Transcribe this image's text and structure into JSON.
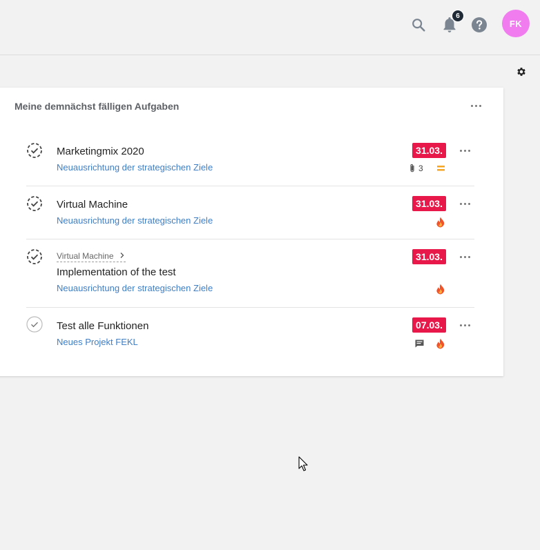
{
  "header": {
    "notification_count": "6",
    "avatar_initials": "FK",
    "avatar_color": "#f07cf0"
  },
  "widget": {
    "title": "Meine demnächst fälligen Aufgaben",
    "tasks": [
      {
        "title": "Marketingmix 2020",
        "project": "Neuausrichtung der strategischen Ziele",
        "due": "31.03.",
        "status_icon": "dashed-check-circle-icon",
        "attachments": "3",
        "priority_icon": "equals-priority-icon"
      },
      {
        "title": "Virtual Machine",
        "project": "Neuausrichtung der strategischen Ziele",
        "due": "31.03.",
        "status_icon": "dashed-check-circle-icon",
        "priority_icon": "fire-icon"
      },
      {
        "parent": "Virtual Machine",
        "title": "Implementation of the test",
        "project": "Neuausrichtung der strategischen Ziele",
        "due": "31.03.",
        "status_icon": "dashed-check-circle-icon",
        "priority_icon": "fire-icon"
      },
      {
        "title": "Test alle Funktionen",
        "project": "Neues Projekt FEKL",
        "due": "07.03.",
        "status_icon": "check-circle-icon",
        "comment_icon": "comment-icon",
        "priority_icon": "fire-icon"
      }
    ]
  },
  "colors": {
    "due_badge": "#e8194a",
    "link": "#3d7ec6",
    "priority_equals": "#f5a623",
    "fire": "#f0522a"
  }
}
